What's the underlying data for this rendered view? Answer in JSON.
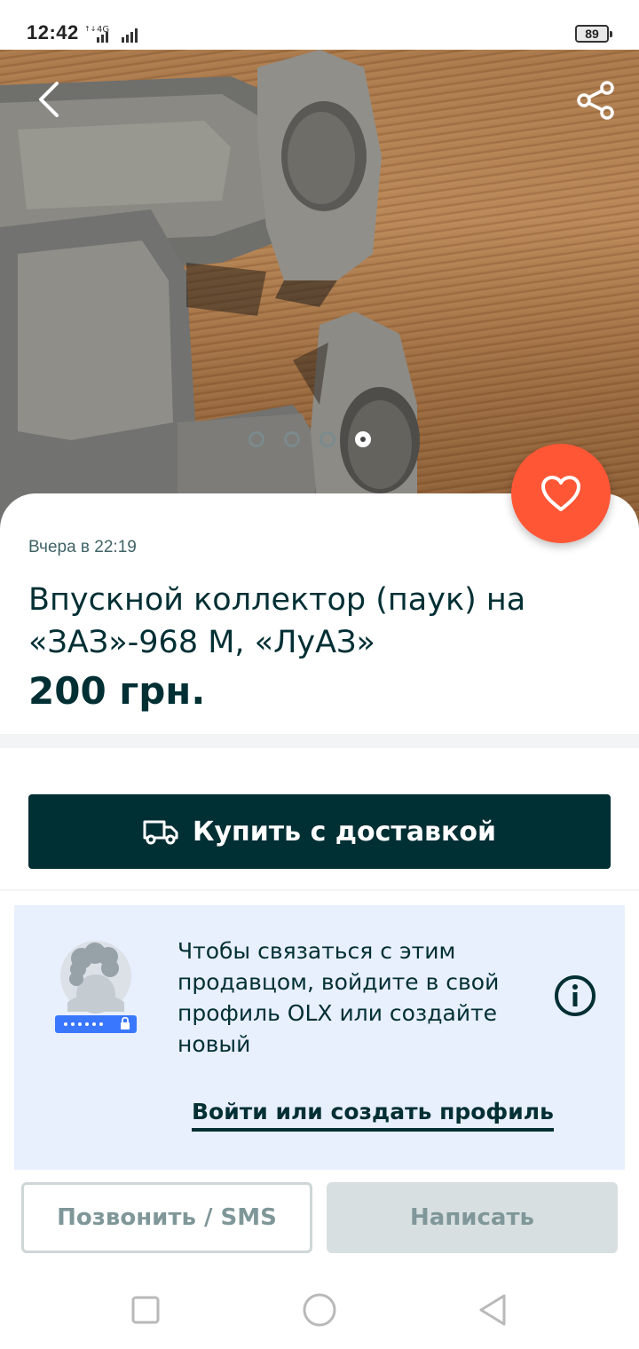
{
  "status_bar": {
    "time": "12:42",
    "network": "4G",
    "battery": "89"
  },
  "gallery": {
    "image_alt": "Впускной коллектор (паук)",
    "slide_count": 4,
    "active_slide": 4,
    "icons": {
      "back": "chevron-left-icon",
      "share": "share-icon",
      "favorite": "heart-icon"
    }
  },
  "listing": {
    "posted": "Вчера в 22:19",
    "title": "Впускной коллектор (паук) на «ЗАЗ»-968 М, «ЛуАЗ»",
    "price": "200 грн."
  },
  "delivery": {
    "button_label": "Купить с доставкой",
    "icon": "truck-icon"
  },
  "login_prompt": {
    "message": "Чтобы связаться с этим продавцом, войдите в свой профиль OLX или создайте новый",
    "link_label": "Войти или создать профиль",
    "icon": "info-icon"
  },
  "actions": {
    "call_label": "Позвонить / SMS",
    "write_label": "Написать"
  },
  "colors": {
    "primary": "#002f34",
    "favorite": "#ff5636",
    "login_bg": "#e8effd",
    "disabled": "#d8dfe0"
  }
}
